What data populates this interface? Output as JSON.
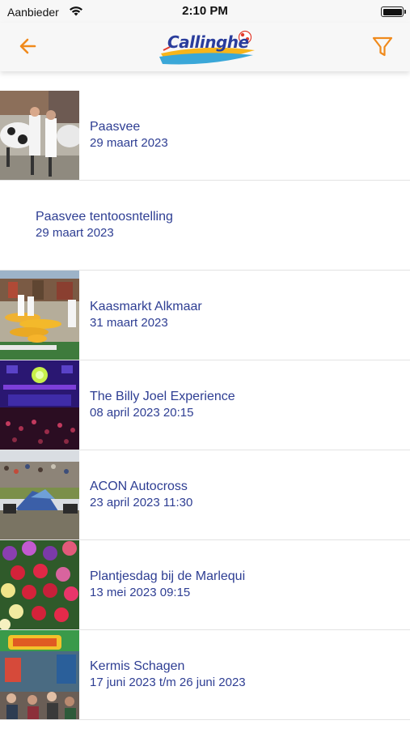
{
  "status_bar": {
    "carrier": "Aanbieder",
    "time": "2:10 PM"
  },
  "nav": {
    "back_icon": "arrow-left-icon",
    "filter_icon": "filter-funnel-icon",
    "logo_text": "Callinghe",
    "accent_color": "#f08a1c"
  },
  "events": [
    {
      "title": "Paasvee",
      "date": "29 maart 2023",
      "has_thumb": true
    },
    {
      "title": "Paasvee tentoosntelling",
      "date": "29 maart 2023",
      "has_thumb": false
    },
    {
      "title": "Kaasmarkt Alkmaar",
      "date": "31 maart 2023",
      "has_thumb": true
    },
    {
      "title": "The Billy Joel Experience",
      "date": "08 april 2023 20:15",
      "has_thumb": true
    },
    {
      "title": "ACON Autocross",
      "date": "23 april 2023 11:30",
      "has_thumb": true
    },
    {
      "title": "Plantjesdag bij de Marlequi",
      "date": "13 mei 2023 09:15",
      "has_thumb": true
    },
    {
      "title": "Kermis Schagen",
      "date": "17 juni 2023 t/m 26 juni 2023",
      "has_thumb": true
    }
  ]
}
